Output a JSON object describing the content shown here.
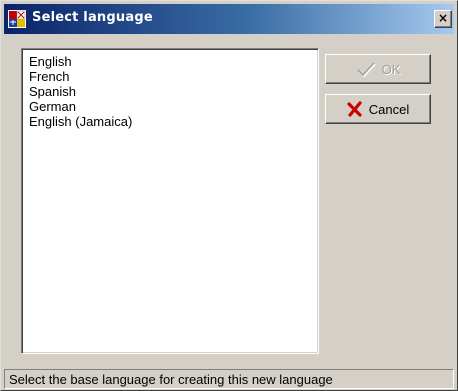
{
  "window": {
    "title": "Select language",
    "close_glyph": "×",
    "titlebar_color": "#0a246a",
    "face_color": "#d4d0c8",
    "app_icon": "language-flag-icon"
  },
  "languages": {
    "items": [
      "English",
      "French",
      "Spanish",
      "German",
      "English (Jamaica)"
    ]
  },
  "buttons": {
    "ok_label": "OK",
    "ok_enabled": false,
    "ok_icon": "checkmark-icon",
    "cancel_label": "Cancel",
    "cancel_icon": "red-x-icon",
    "cancel_icon_color": "#cc0000"
  },
  "status": {
    "text": "Select the base language for creating this new language"
  }
}
